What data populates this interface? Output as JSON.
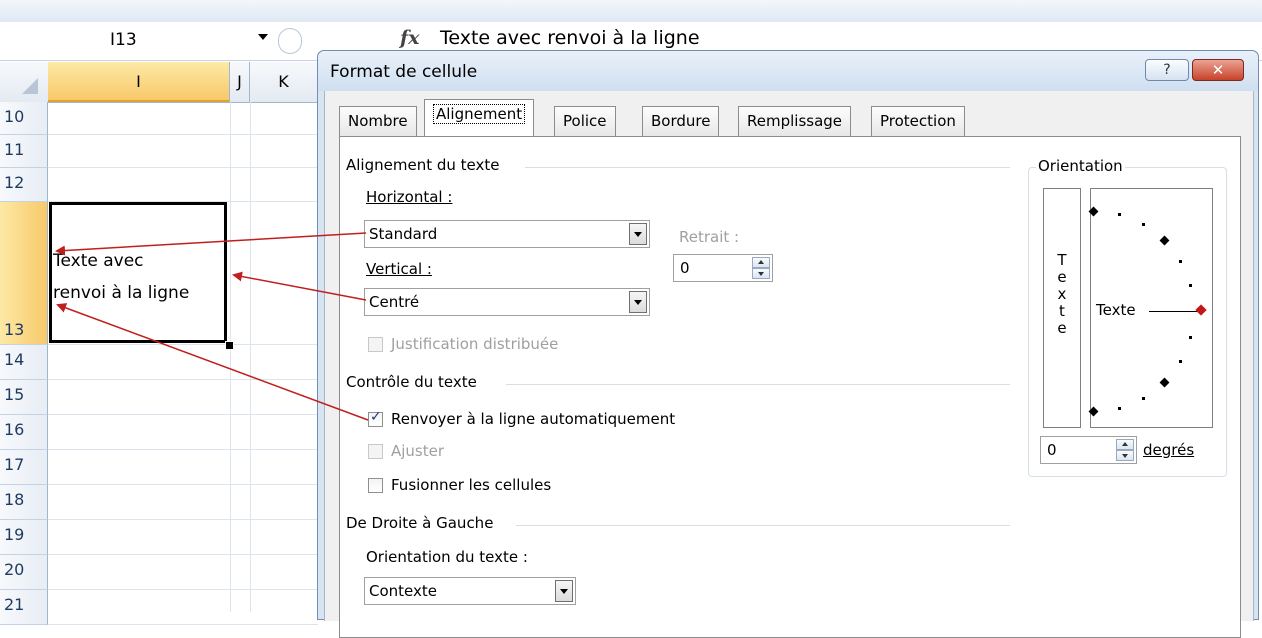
{
  "excel": {
    "name_box": "I13",
    "formula_icon": "fx",
    "formula_content": "Texte avec renvoi à la ligne",
    "columns": [
      "I",
      "J",
      "K"
    ],
    "rows": [
      "10",
      "11",
      "12",
      "13",
      "14",
      "15",
      "16",
      "17",
      "18",
      "19",
      "20",
      "21"
    ],
    "cell_text_line1": "Texte avec",
    "cell_text_line2": "renvoi à la ligne"
  },
  "dialog": {
    "title": "Format de cellule",
    "help_label": "?",
    "close_label": "✕",
    "tabs": [
      {
        "label": "Nombre",
        "active": false
      },
      {
        "label": "Alignement",
        "active": true
      },
      {
        "label": "Police",
        "active": false
      },
      {
        "label": "Bordure",
        "active": false
      },
      {
        "label": "Remplissage",
        "active": false
      },
      {
        "label": "Protection",
        "active": false
      }
    ],
    "text_alignment": {
      "group_title": "Alignement du texte",
      "horizontal_label": "Horizontal :",
      "horizontal_value": "Standard",
      "indent_label": "Retrait :",
      "indent_value": "0",
      "vertical_label": "Vertical :",
      "vertical_value": "Centré",
      "justify_distributed_label": "Justification distribuée",
      "justify_distributed_checked": false
    },
    "text_control": {
      "group_title": "Contrôle du texte",
      "wrap_text_label": "Renvoyer à la ligne automatiquement",
      "wrap_text_checked": true,
      "shrink_label": "Ajuster",
      "shrink_checked": false,
      "merge_label": "Fusionner les cellules",
      "merge_checked": false
    },
    "rtl": {
      "group_title": "De Droite à Gauche",
      "direction_label": "Orientation du texte :",
      "direction_value": "Contexte"
    },
    "orientation": {
      "group_title": "Orientation",
      "vertical_text": "Texte",
      "dial_text": "Texte",
      "degrees_value": "0",
      "degrees_label": "degrés"
    }
  },
  "colors": {
    "arrow": "#c0201d",
    "selected_column": "#f7c96a",
    "dialog_frame": "#d7e4f2"
  }
}
